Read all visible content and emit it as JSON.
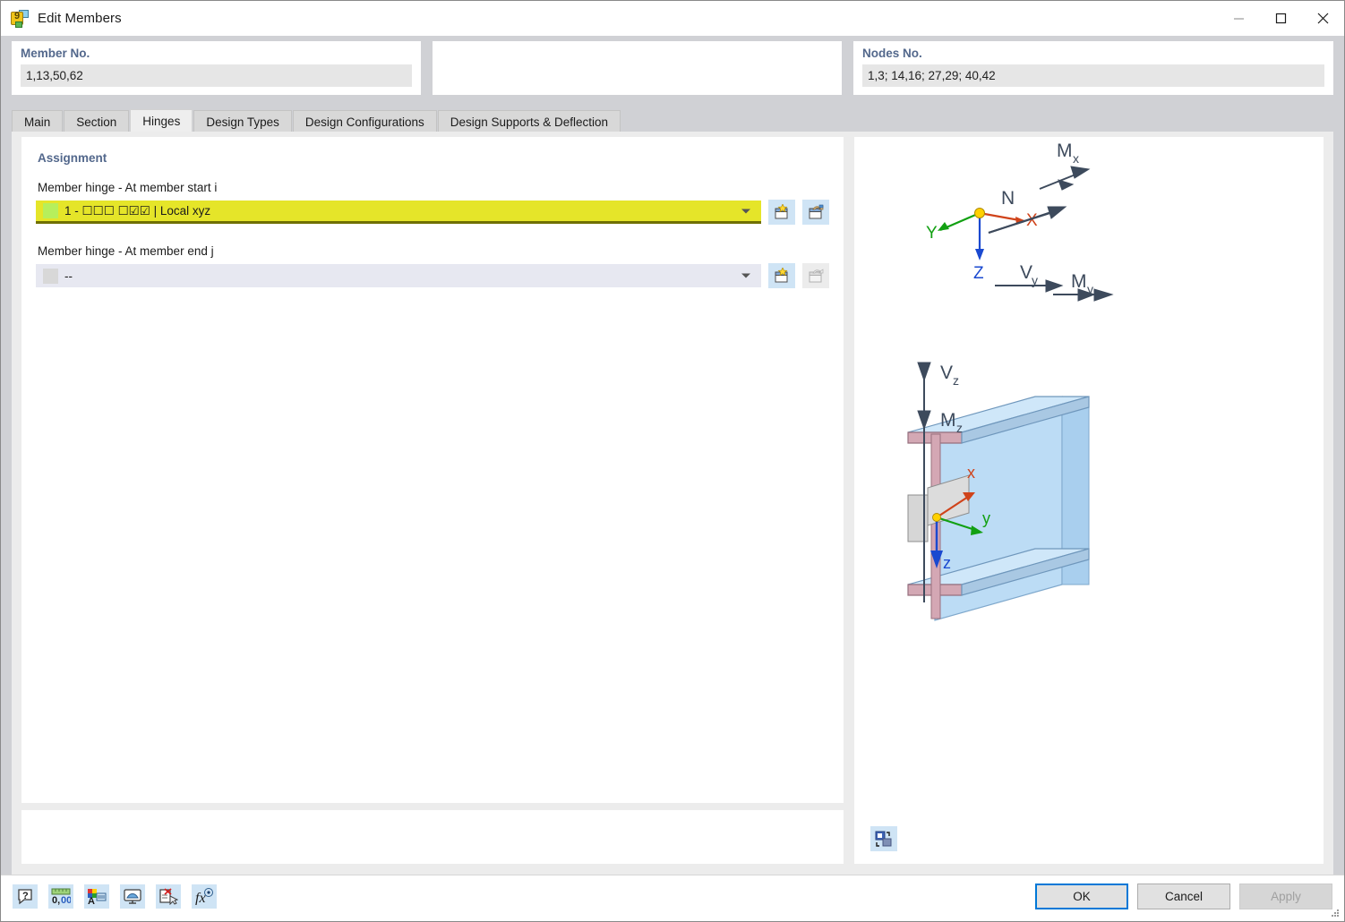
{
  "window": {
    "title": "Edit Members",
    "icon": "app-icon",
    "controls": [
      {
        "name": "minimize-button",
        "glyph": "minimize"
      },
      {
        "name": "maximize-button",
        "glyph": "maximize"
      },
      {
        "name": "close-button",
        "glyph": "close"
      }
    ]
  },
  "header": {
    "member": {
      "label": "Member No.",
      "value": "1,13,50,62"
    },
    "middle": {
      "label": "",
      "value": ""
    },
    "nodes": {
      "label": "Nodes No.",
      "value": "1,3; 14,16; 27,29; 40,42"
    }
  },
  "tabs": [
    {
      "label": "Main",
      "active": false
    },
    {
      "label": "Section",
      "active": false
    },
    {
      "label": "Hinges",
      "active": true
    },
    {
      "label": "Design Types",
      "active": false
    },
    {
      "label": "Design Configurations",
      "active": false
    },
    {
      "label": "Design Supports & Deflection",
      "active": false
    }
  ],
  "assignment": {
    "title": "Assignment",
    "start": {
      "label": "Member hinge - At member start i",
      "value": "1 - ☐☐☐  ☐☑☑ | Local xyz",
      "swatch_color": "#b6ef5c",
      "highlight_color": "#e5e529",
      "new_button": "new-hinge-start-button",
      "edit_button": "edit-hinge-start-button",
      "new_enabled": true,
      "edit_enabled": true
    },
    "end": {
      "label": "Member hinge - At member end j",
      "value": "--",
      "swatch_color": "#d8d8d8",
      "new_button": "new-hinge-end-button",
      "edit_button": "edit-hinge-end-button",
      "new_enabled": true,
      "edit_enabled": false
    }
  },
  "preview": {
    "global_axes": [
      {
        "name": "X",
        "color": "#d0431a"
      },
      {
        "name": "Y",
        "color": "#12a012"
      },
      {
        "name": "Z",
        "color": "#1a49d0"
      }
    ],
    "local_axes": [
      {
        "name": "x",
        "color": "#d0431a"
      },
      {
        "name": "y",
        "color": "#12a012"
      },
      {
        "name": "z",
        "color": "#1a49d0"
      }
    ],
    "force_labels": [
      {
        "name": "N",
        "sub": ""
      },
      {
        "name": "M",
        "sub": "x"
      },
      {
        "name": "V",
        "sub": "y"
      },
      {
        "name": "M",
        "sub": "y"
      },
      {
        "name": "V",
        "sub": "z"
      },
      {
        "name": "M",
        "sub": "z"
      }
    ],
    "view_toggle": "toggle-view-button"
  },
  "toolbar": {
    "icons": [
      {
        "name": "help-icon",
        "title": "Help"
      },
      {
        "name": "units-icon",
        "title": "Units and Decimal Places"
      },
      {
        "name": "display-properties-icon",
        "title": "Display Properties"
      },
      {
        "name": "visualization-icon",
        "title": "Visualization"
      },
      {
        "name": "delete-comment-icon",
        "title": "Delete"
      },
      {
        "name": "formula-icon",
        "title": "Functions"
      }
    ]
  },
  "buttons": {
    "ok": {
      "label": "OK",
      "enabled": true,
      "default": true
    },
    "cancel": {
      "label": "Cancel",
      "enabled": true,
      "default": false
    },
    "apply": {
      "label": "Apply",
      "enabled": false,
      "default": false
    }
  },
  "colors": {
    "accent": "#0078d7",
    "section_title": "#53688c",
    "highlight_yellow": "#e5e529",
    "dialog_bg": "#d0d1d5",
    "content_bg": "#ececec"
  }
}
